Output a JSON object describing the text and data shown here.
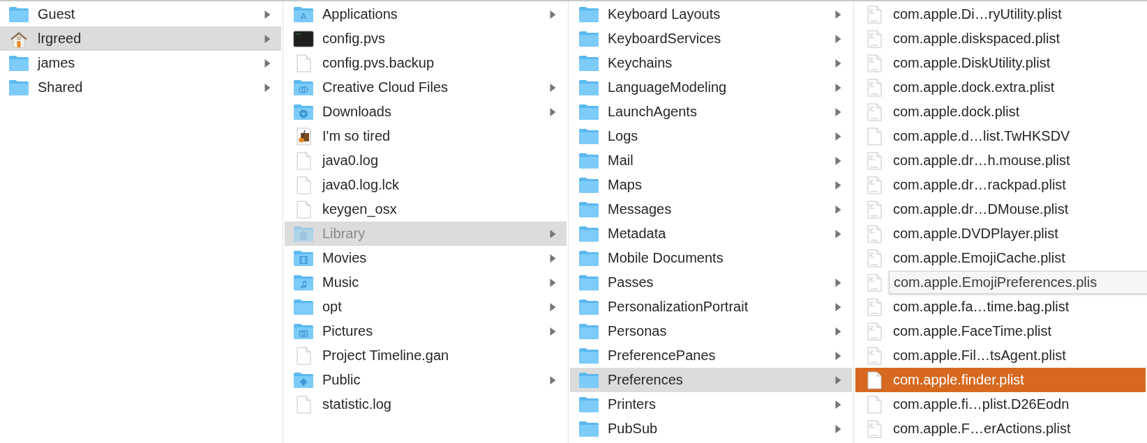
{
  "columns": [
    {
      "active": false,
      "items": [
        {
          "name": "Guest",
          "kind": "folder",
          "arrow": true,
          "selected": false,
          "hidden": false,
          "popup": false
        },
        {
          "name": "lrgreed",
          "kind": "home",
          "arrow": true,
          "selected": true,
          "hidden": false,
          "popup": false
        },
        {
          "name": "james",
          "kind": "folder",
          "arrow": true,
          "selected": false,
          "hidden": false,
          "popup": false
        },
        {
          "name": "Shared",
          "kind": "folder",
          "arrow": true,
          "selected": false,
          "hidden": false,
          "popup": false
        }
      ]
    },
    {
      "active": false,
      "items": [
        {
          "name": "Applications",
          "kind": "apps-folder",
          "arrow": true,
          "selected": false,
          "hidden": false,
          "popup": false
        },
        {
          "name": "config.pvs",
          "kind": "terminal",
          "arrow": false,
          "selected": false,
          "hidden": false,
          "popup": false
        },
        {
          "name": "config.pvs.backup",
          "kind": "document",
          "arrow": false,
          "selected": false,
          "hidden": false,
          "popup": false
        },
        {
          "name": "Creative Cloud Files",
          "kind": "cloud-folder",
          "arrow": true,
          "selected": false,
          "hidden": false,
          "popup": false
        },
        {
          "name": "Downloads",
          "kind": "downloads-folder",
          "arrow": true,
          "selected": false,
          "hidden": false,
          "popup": false
        },
        {
          "name": "I'm so tired",
          "kind": "app",
          "arrow": false,
          "selected": false,
          "hidden": false,
          "popup": false
        },
        {
          "name": "java0.log",
          "kind": "document",
          "arrow": false,
          "selected": false,
          "hidden": false,
          "popup": false
        },
        {
          "name": "java0.log.lck",
          "kind": "document",
          "arrow": false,
          "selected": false,
          "hidden": false,
          "popup": false
        },
        {
          "name": "keygen_osx",
          "kind": "document",
          "arrow": false,
          "selected": false,
          "hidden": false,
          "popup": false
        },
        {
          "name": "Library",
          "kind": "library-folder",
          "arrow": true,
          "selected": true,
          "hidden": true,
          "popup": false
        },
        {
          "name": "Movies",
          "kind": "movies-folder",
          "arrow": true,
          "selected": false,
          "hidden": false,
          "popup": false
        },
        {
          "name": "Music",
          "kind": "music-folder",
          "arrow": true,
          "selected": false,
          "hidden": false,
          "popup": false
        },
        {
          "name": "opt",
          "kind": "folder",
          "arrow": true,
          "selected": false,
          "hidden": false,
          "popup": false
        },
        {
          "name": "Pictures",
          "kind": "pictures-folder",
          "arrow": true,
          "selected": false,
          "hidden": false,
          "popup": false
        },
        {
          "name": "Project Timeline.gan",
          "kind": "document",
          "arrow": false,
          "selected": false,
          "hidden": false,
          "popup": false
        },
        {
          "name": "Public",
          "kind": "public-folder",
          "arrow": true,
          "selected": false,
          "hidden": false,
          "popup": false
        },
        {
          "name": "statistic.log",
          "kind": "document",
          "arrow": false,
          "selected": false,
          "hidden": false,
          "popup": false
        }
      ]
    },
    {
      "active": false,
      "items": [
        {
          "name": "Keyboard Layouts",
          "kind": "folder",
          "arrow": true,
          "selected": false,
          "hidden": false,
          "popup": false
        },
        {
          "name": "KeyboardServices",
          "kind": "folder",
          "arrow": true,
          "selected": false,
          "hidden": false,
          "popup": false
        },
        {
          "name": "Keychains",
          "kind": "folder",
          "arrow": true,
          "selected": false,
          "hidden": false,
          "popup": false
        },
        {
          "name": "LanguageModeling",
          "kind": "folder",
          "arrow": true,
          "selected": false,
          "hidden": false,
          "popup": false
        },
        {
          "name": "LaunchAgents",
          "kind": "folder",
          "arrow": true,
          "selected": false,
          "hidden": false,
          "popup": false
        },
        {
          "name": "Logs",
          "kind": "folder",
          "arrow": true,
          "selected": false,
          "hidden": false,
          "popup": false
        },
        {
          "name": "Mail",
          "kind": "folder",
          "arrow": true,
          "selected": false,
          "hidden": false,
          "popup": false
        },
        {
          "name": "Maps",
          "kind": "folder",
          "arrow": true,
          "selected": false,
          "hidden": false,
          "popup": false
        },
        {
          "name": "Messages",
          "kind": "folder",
          "arrow": true,
          "selected": false,
          "hidden": false,
          "popup": false
        },
        {
          "name": "Metadata",
          "kind": "folder",
          "arrow": true,
          "selected": false,
          "hidden": false,
          "popup": false
        },
        {
          "name": "Mobile Documents",
          "kind": "folder",
          "arrow": false,
          "selected": false,
          "hidden": false,
          "popup": false
        },
        {
          "name": "Passes",
          "kind": "folder",
          "arrow": true,
          "selected": false,
          "hidden": false,
          "popup": false
        },
        {
          "name": "PersonalizationPortrait",
          "kind": "folder",
          "arrow": true,
          "selected": false,
          "hidden": false,
          "popup": false
        },
        {
          "name": "Personas",
          "kind": "folder",
          "arrow": true,
          "selected": false,
          "hidden": false,
          "popup": false
        },
        {
          "name": "PreferencePanes",
          "kind": "folder",
          "arrow": true,
          "selected": false,
          "hidden": false,
          "popup": false
        },
        {
          "name": "Preferences",
          "kind": "folder",
          "arrow": true,
          "selected": true,
          "hidden": false,
          "popup": false
        },
        {
          "name": "Printers",
          "kind": "folder",
          "arrow": true,
          "selected": false,
          "hidden": false,
          "popup": false
        },
        {
          "name": "PubSub",
          "kind": "folder",
          "arrow": true,
          "selected": false,
          "hidden": false,
          "popup": false
        }
      ]
    },
    {
      "active": true,
      "items": [
        {
          "name": "com.apple.Di…ryUtility.plist",
          "kind": "plist",
          "arrow": false,
          "selected": false,
          "hidden": false,
          "popup": false
        },
        {
          "name": "com.apple.diskspaced.plist",
          "kind": "plist",
          "arrow": false,
          "selected": false,
          "hidden": false,
          "popup": false
        },
        {
          "name": "com.apple.DiskUtility.plist",
          "kind": "plist",
          "arrow": false,
          "selected": false,
          "hidden": false,
          "popup": false
        },
        {
          "name": "com.apple.dock.extra.plist",
          "kind": "plist",
          "arrow": false,
          "selected": false,
          "hidden": false,
          "popup": false
        },
        {
          "name": "com.apple.dock.plist",
          "kind": "plist",
          "arrow": false,
          "selected": false,
          "hidden": false,
          "popup": false
        },
        {
          "name": "com.apple.d…list.TwHKSDV",
          "kind": "document",
          "arrow": false,
          "selected": false,
          "hidden": false,
          "popup": false
        },
        {
          "name": "com.apple.dr…h.mouse.plist",
          "kind": "plist",
          "arrow": false,
          "selected": false,
          "hidden": false,
          "popup": false
        },
        {
          "name": "com.apple.dr…rackpad.plist",
          "kind": "plist",
          "arrow": false,
          "selected": false,
          "hidden": false,
          "popup": false
        },
        {
          "name": "com.apple.dr…DMouse.plist",
          "kind": "plist",
          "arrow": false,
          "selected": false,
          "hidden": false,
          "popup": false
        },
        {
          "name": "com.apple.DVDPlayer.plist",
          "kind": "plist",
          "arrow": false,
          "selected": false,
          "hidden": false,
          "popup": false
        },
        {
          "name": "com.apple.EmojiCache.plist",
          "kind": "plist",
          "arrow": false,
          "selected": false,
          "hidden": false,
          "popup": false
        },
        {
          "name": "com.apple.EmojiPreferences.plis",
          "kind": "plist",
          "arrow": false,
          "selected": false,
          "hidden": false,
          "popup": true
        },
        {
          "name": "com.apple.fa…time.bag.plist",
          "kind": "plist",
          "arrow": false,
          "selected": false,
          "hidden": false,
          "popup": false
        },
        {
          "name": "com.apple.FaceTime.plist",
          "kind": "plist",
          "arrow": false,
          "selected": false,
          "hidden": false,
          "popup": false
        },
        {
          "name": "com.apple.Fil…tsAgent.plist",
          "kind": "plist",
          "arrow": false,
          "selected": false,
          "hidden": false,
          "popup": false
        },
        {
          "name": "com.apple.finder.plist",
          "kind": "document",
          "arrow": false,
          "selected": true,
          "hidden": false,
          "popup": false
        },
        {
          "name": "com.apple.fi…plist.D26Eodn",
          "kind": "document",
          "arrow": false,
          "selected": false,
          "hidden": false,
          "popup": false
        },
        {
          "name": "com.apple.F…erActions.plist",
          "kind": "plist",
          "arrow": false,
          "selected": false,
          "hidden": false,
          "popup": false
        }
      ]
    }
  ]
}
